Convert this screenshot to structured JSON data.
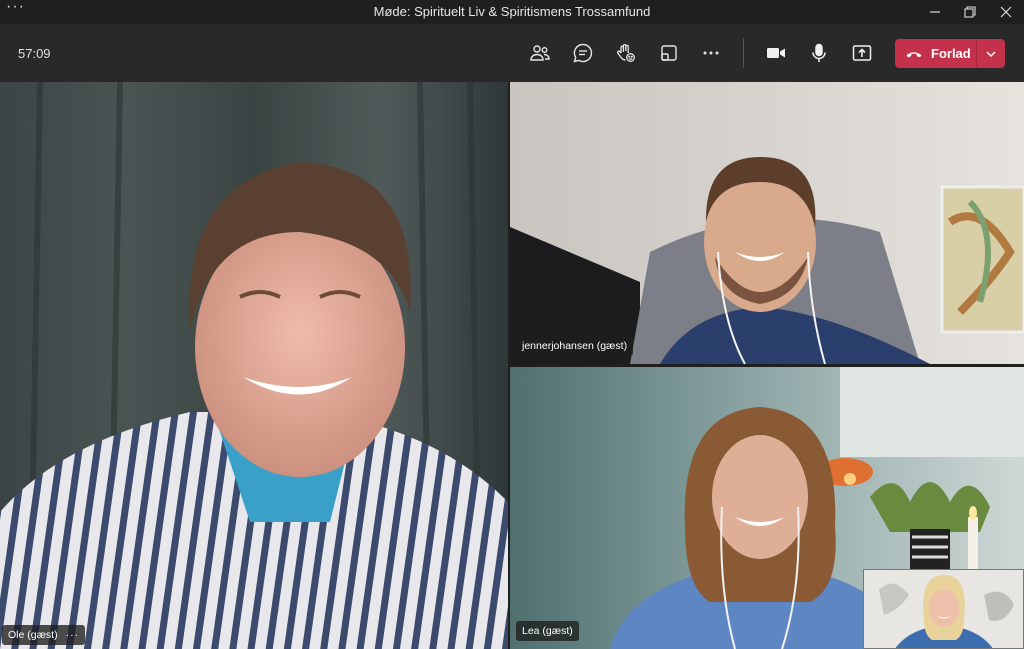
{
  "window": {
    "title": "Møde: Spirituelt Liv & Spiritismens Trossamfund"
  },
  "toolbar": {
    "timer": "57:09",
    "leave_label": "Forlad"
  },
  "participants": [
    {
      "name": "Ole (gæst)"
    },
    {
      "name": "jennerjohansen (gæst)"
    },
    {
      "name": "Lea (gæst)"
    }
  ],
  "colors": {
    "leave": "#c4314b",
    "toolbar": "#292929",
    "titlebar": "#1f1f1f"
  }
}
